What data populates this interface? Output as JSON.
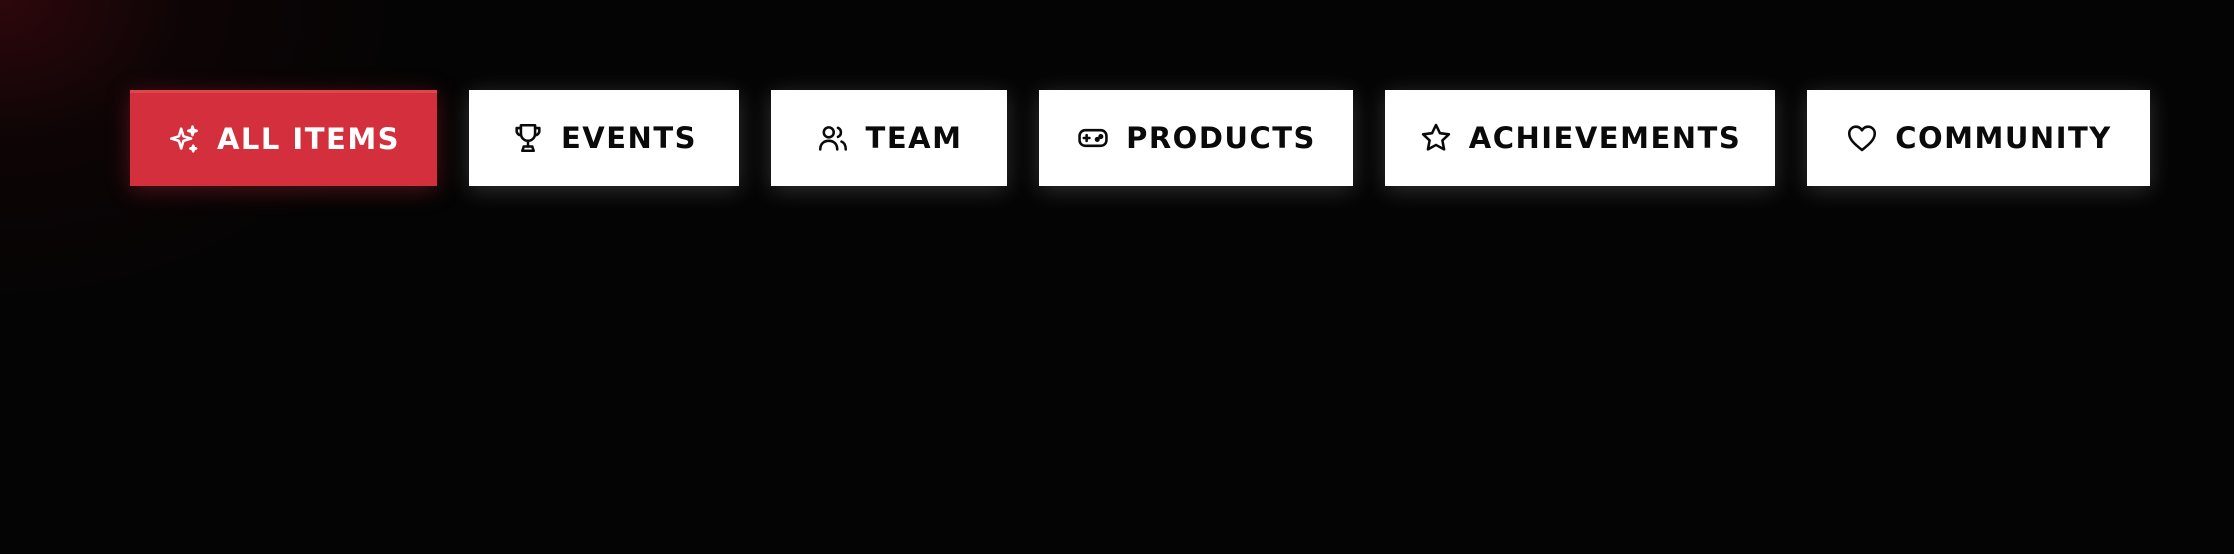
{
  "filters": {
    "active_color": "#d32f3c",
    "inactive_color": "#ffffff",
    "items": [
      {
        "label": "ALL ITEMS",
        "icon": "sparkles-icon",
        "active": true
      },
      {
        "label": "EVENTS",
        "icon": "trophy-icon",
        "active": false
      },
      {
        "label": "TEAM",
        "icon": "users-icon",
        "active": false
      },
      {
        "label": "PRODUCTS",
        "icon": "gamepad-icon",
        "active": false
      },
      {
        "label": "ACHIEVEMENTS",
        "icon": "star-icon",
        "active": false
      },
      {
        "label": "COMMUNITY",
        "icon": "heart-icon",
        "active": false
      }
    ]
  }
}
